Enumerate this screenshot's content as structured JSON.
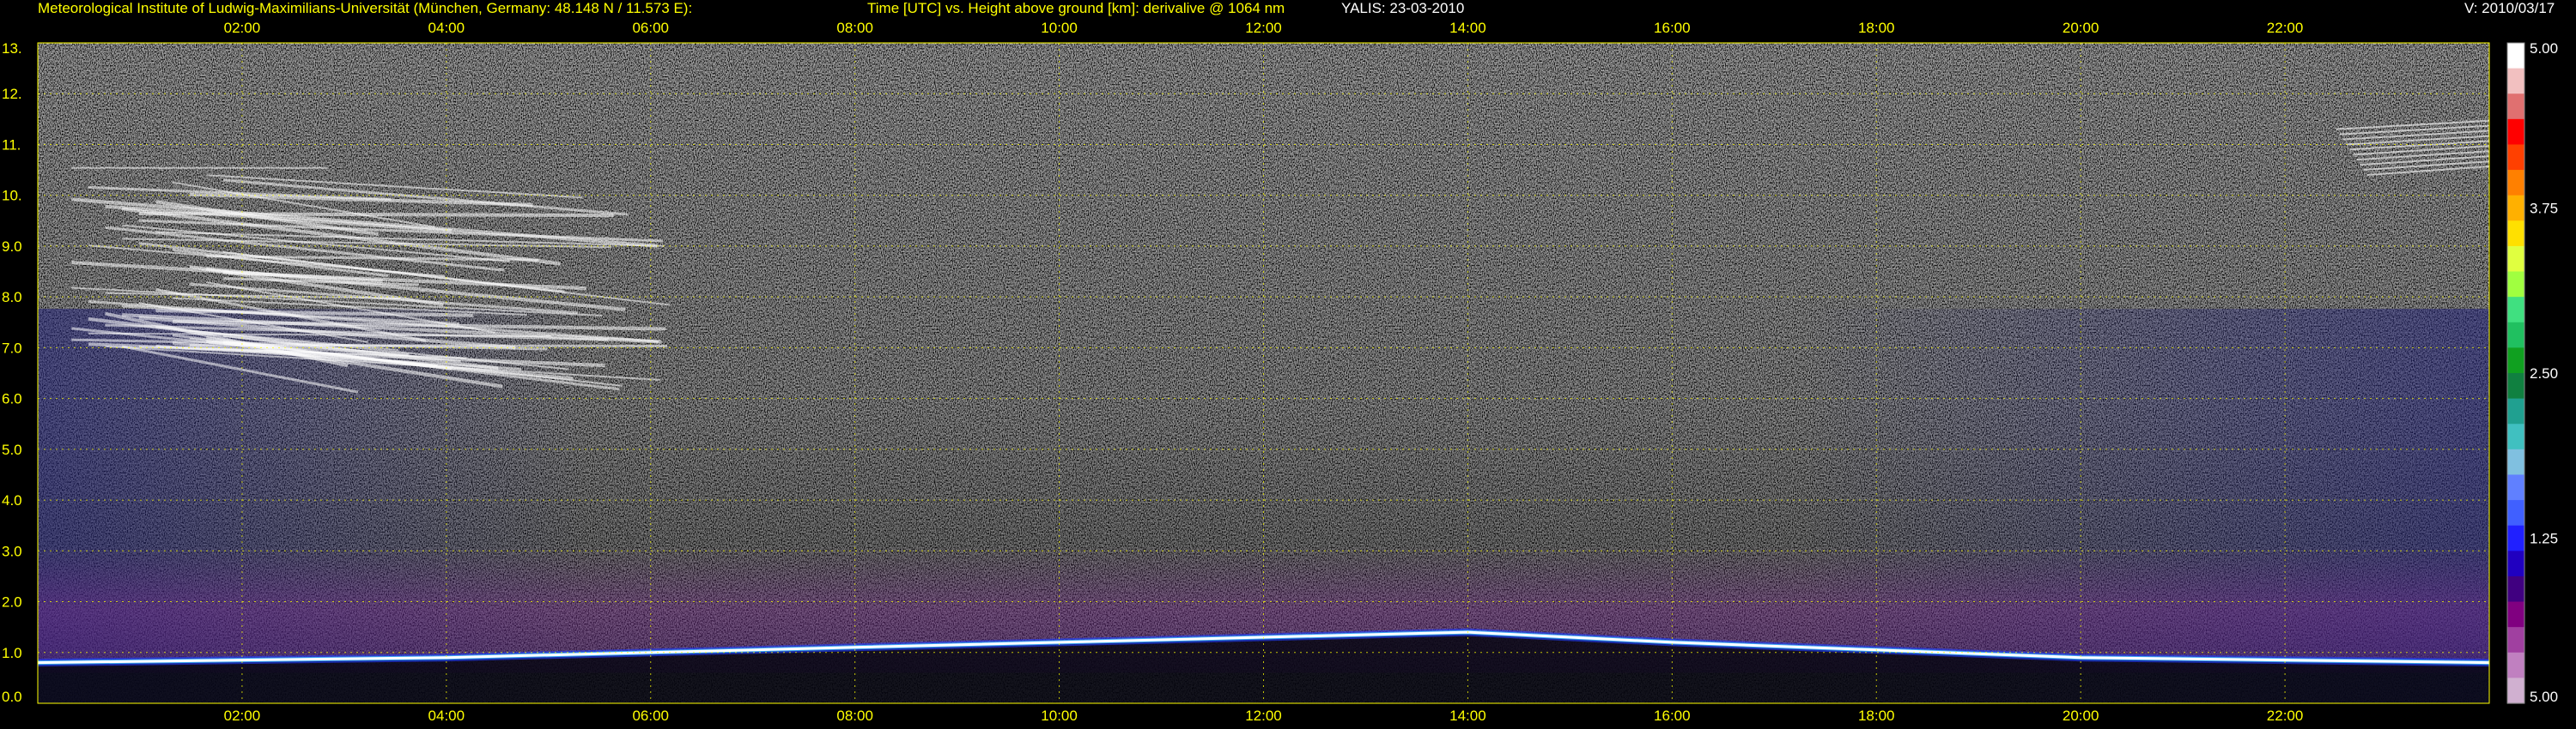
{
  "header": {
    "institute": "Meteorological Institute of Ludwig-Maximilians-Universität (München, Germany: 48.148 N / 11.573 E):",
    "plot_desc": "Time [UTC] vs. Height above ground [km]: derivalive @ 1064 nm",
    "system": "YALIS: 23-03-2010",
    "version": "V: 2010/03/17"
  },
  "chart_data": {
    "type": "heatmap",
    "title": "Time [UTC] vs. Height above ground [km]: derivalive @ 1064 nm",
    "xlabel": "Time [UTC]",
    "ylabel": "Height above ground [km]",
    "x_ticks": [
      "02:00",
      "04:00",
      "06:00",
      "08:00",
      "10:00",
      "12:00",
      "14:00",
      "16:00",
      "18:00",
      "20:00",
      "22:00"
    ],
    "x_tick_hours": [
      2,
      4,
      6,
      8,
      10,
      12,
      14,
      16,
      18,
      20,
      22
    ],
    "xlim_hours": [
      0.0,
      24.0
    ],
    "y_ticks": [
      "0.0",
      "1.0",
      "2.0",
      "3.0",
      "4.0",
      "5.0",
      "6.0",
      "7.0",
      "8.0",
      "9.0",
      "10.",
      "11.",
      "12.",
      "13."
    ],
    "y_tick_values": [
      0,
      1,
      2,
      3,
      4,
      5,
      6,
      7,
      8,
      9,
      10,
      11,
      12,
      13
    ],
    "ylim_km": [
      0,
      13
    ],
    "grid": true,
    "colorbar": {
      "labels": [
        "5.00",
        "3.75",
        "2.50",
        "1.25",
        "5.00"
      ],
      "label_values": [
        5.0,
        3.75,
        2.5,
        1.25,
        0.0
      ],
      "colors": [
        "#ffffff",
        "#f2c0c0",
        "#e07070",
        "#ff0000",
        "#ff4000",
        "#ff8000",
        "#ffb000",
        "#ffe000",
        "#e0ff40",
        "#a0ff40",
        "#40e080",
        "#20c060",
        "#10a020",
        "#108040",
        "#20a090",
        "#40c0c0",
        "#80c0e0",
        "#6080ff",
        "#4060ff",
        "#2020ff",
        "#2000c0",
        "#400080",
        "#800080",
        "#a040a0",
        "#c080c0",
        "#d0b0d0"
      ]
    },
    "features": [
      {
        "name": "cirrus_layer",
        "time_start_h": 0.0,
        "time_end_h": 6.6,
        "height_min_km": 6.8,
        "height_max_km": 11.2
      },
      {
        "name": "boundary_layer_top",
        "time_h": [
          0.0,
          4.0,
          8.0,
          12.0,
          14.0,
          16.0,
          18.0,
          20.0,
          24.0
        ],
        "height_km": [
          0.8,
          0.9,
          1.1,
          1.3,
          1.4,
          1.2,
          1.05,
          0.9,
          0.8
        ]
      },
      {
        "name": "cirrus_cell_late",
        "time_start_h": 22.5,
        "time_end_h": 24.0,
        "height_min_km": 10.3,
        "height_max_km": 11.3
      }
    ]
  }
}
